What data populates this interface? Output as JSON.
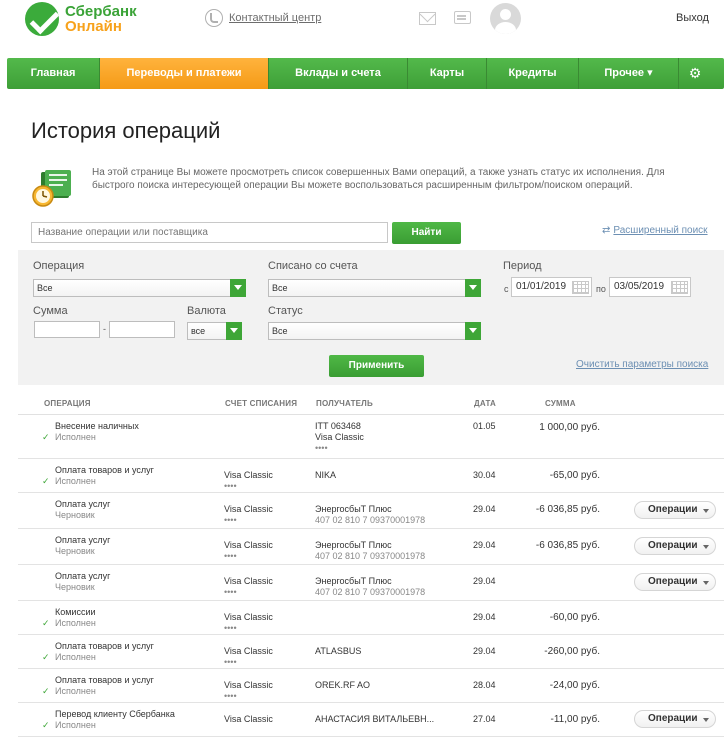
{
  "header": {
    "logo_line1": "Сбербанк",
    "logo_line2": "Онлайн",
    "contact_label": "Контактный центр",
    "logout_label": "Выход"
  },
  "nav": {
    "items": [
      {
        "label": "Главная"
      },
      {
        "label": "Переводы и платежи",
        "active": true
      },
      {
        "label": "Вклады и счета"
      },
      {
        "label": "Карты"
      },
      {
        "label": "Кредиты"
      },
      {
        "label": "Прочее ▾"
      }
    ]
  },
  "page": {
    "title": "История операций",
    "intro": "На этой странице Вы можете просмотреть список совершенных Вами операций, а также узнать статус их исполнения. Для быстрого поиска интересующей операции Вы можете воспользоваться расширенным фильтром/поиском операций."
  },
  "search": {
    "placeholder": "Название операции или поставщика",
    "button_label": "Найти",
    "advanced_label": "Расширенный поиск"
  },
  "filter": {
    "operation_label": "Операция",
    "operation_value": "Все",
    "account_label": "Списано со счета",
    "account_value": "Все",
    "period_label": "Период",
    "from_label": "с",
    "from_value": "01/01/2019",
    "to_label": "по",
    "to_value": "03/05/2019",
    "sum_label": "Сумма",
    "sum_dash": "-",
    "currency_label": "Валюта",
    "currency_value": "все",
    "status_label": "Статус",
    "status_value": "Все",
    "apply_label": "Применить",
    "reset_label": "Очистить параметры поиска"
  },
  "table": {
    "headers": {
      "operation": "ОПЕРАЦИЯ",
      "account": "СЧЕТ СПИСАНИЯ",
      "recipient": "ПОЛУЧАТЕЛЬ",
      "date": "ДАТА",
      "amount": "СУММА"
    },
    "ops_label": "Операции",
    "rows": [
      {
        "name": "Внесение наличных",
        "status": "Исполнен",
        "account": "",
        "account_sub": "",
        "recipient": "ITT 063468",
        "recipient_sub": "Visa Classic",
        "recipient_sub2": "••••",
        "date": "01.05",
        "amount": "1 000,00 руб.",
        "done": true,
        "ops": false
      },
      {
        "name": "Оплата товаров и услуг",
        "status": "Исполнен",
        "account": "Visa Classic",
        "account_sub": "••••",
        "recipient": "NIKA",
        "recipient_sub": "",
        "recipient_sub2": "",
        "date": "30.04",
        "amount": "-65,00 руб.",
        "done": true,
        "ops": false
      },
      {
        "name": "Оплата услуг",
        "status": "Черновик",
        "account": "Visa Classic",
        "account_sub": "••••",
        "recipient": "ЭнергосбыТ Плюс",
        "recipient_sub": "407 02 810 7 09370001978",
        "recipient_sub2": "",
        "date": "29.04",
        "amount": "-6 036,85 руб.",
        "done": false,
        "ops": true
      },
      {
        "name": "Оплата услуг",
        "status": "Черновик",
        "account": "Visa Classic",
        "account_sub": "••••",
        "recipient": "ЭнергосбыТ Плюс",
        "recipient_sub": "407 02 810 7 09370001978",
        "recipient_sub2": "",
        "date": "29.04",
        "amount": "-6 036,85 руб.",
        "done": false,
        "ops": true
      },
      {
        "name": "Оплата услуг",
        "status": "Черновик",
        "account": "Visa Classic",
        "account_sub": "••••",
        "recipient": "ЭнергосбыТ Плюс",
        "recipient_sub": "407 02 810 7 09370001978",
        "recipient_sub2": "",
        "date": "29.04",
        "amount": "",
        "done": false,
        "ops": true
      },
      {
        "name": "Комиссии",
        "status": "Исполнен",
        "account": "Visa Classic",
        "account_sub": "••••",
        "recipient": "",
        "recipient_sub": "",
        "recipient_sub2": "",
        "date": "29.04",
        "amount": "-60,00 руб.",
        "done": true,
        "ops": false
      },
      {
        "name": "Оплата товаров и услуг",
        "status": "Исполнен",
        "account": "Visa Classic",
        "account_sub": "••••",
        "recipient": "ATLASBUS",
        "recipient_sub": "",
        "recipient_sub2": "",
        "date": "29.04",
        "amount": "-260,00 руб.",
        "done": true,
        "ops": false
      },
      {
        "name": "Оплата товаров и услуг",
        "status": "Исполнен",
        "account": "Visa Classic",
        "account_sub": "••••",
        "recipient": "OREK.RF AO",
        "recipient_sub": "",
        "recipient_sub2": "",
        "date": "28.04",
        "amount": "-24,00 руб.",
        "done": true,
        "ops": false
      },
      {
        "name": "Перевод клиенту Сбербанка",
        "status": "Исполнен",
        "account": "Visa Classic",
        "account_sub": "",
        "recipient": "АНАСТАСИЯ ВИТАЛЬЕВН...",
        "recipient_sub": "",
        "recipient_sub2": "",
        "date": "27.04",
        "amount": "-11,00 руб.",
        "done": true,
        "ops": true
      }
    ]
  }
}
